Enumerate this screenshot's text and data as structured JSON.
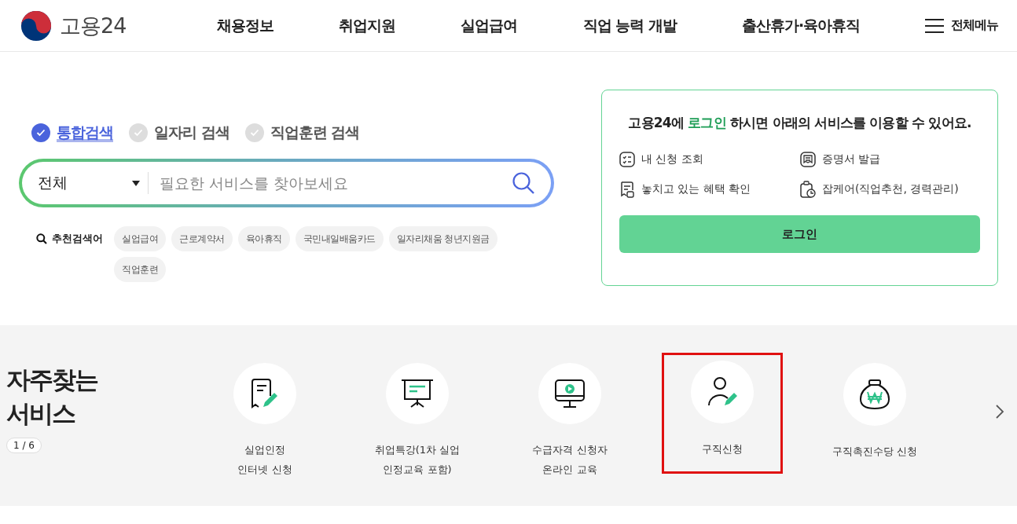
{
  "header": {
    "logo_text": "고용24",
    "nav": [
      "채용정보",
      "취업지원",
      "실업급여",
      "직업 능력 개발",
      "출산휴가·육아휴직"
    ],
    "menu_label": "전체메뉴"
  },
  "search": {
    "tabs": [
      {
        "label": "통합검색",
        "selected": true
      },
      {
        "label": "일자리 검색",
        "selected": false
      },
      {
        "label": "직업훈련 검색",
        "selected": false
      }
    ],
    "category": "전체",
    "placeholder": "필요한 서비스를 찾아보세요",
    "recommended_label": "추천검색어",
    "keywords": [
      "실업급여",
      "근로계약서",
      "육아휴직",
      "국민내일배움카드",
      "일자리채움 청년지원금",
      "직업훈련"
    ]
  },
  "login_card": {
    "message": "고용24에 **로그인** 하시면 아래의 서비스를 이용할 수 있어요.",
    "services": [
      {
        "kind": "checklist",
        "label": "내 신청 조회"
      },
      {
        "kind": "certificate",
        "label": "증명서 발급"
      },
      {
        "kind": "benefit",
        "label": "놓치고 있는 혜택 확인"
      },
      {
        "kind": "clipboard",
        "label": "잡케어(직업추천, 경력관리)"
      }
    ],
    "button": "로그인"
  },
  "frequent": {
    "title": "자주찾는 서비스",
    "pager": "1 / 6",
    "items": [
      {
        "kind": "document",
        "lines": [
          "실업인정",
          "인터넷 신청"
        ],
        "highlighted": false
      },
      {
        "kind": "presentation",
        "lines": [
          "취업특강(1차 실업",
          "인정교육 포함)"
        ],
        "highlighted": false
      },
      {
        "kind": "monitor",
        "lines": [
          "수급자격 신청자",
          "온라인 교육"
        ],
        "highlighted": false
      },
      {
        "kind": "person",
        "lines": [
          "구직신청"
        ],
        "highlighted": true
      },
      {
        "kind": "moneybag",
        "lines": [
          "구직촉진수당 신청"
        ],
        "highlighted": false
      }
    ]
  }
}
